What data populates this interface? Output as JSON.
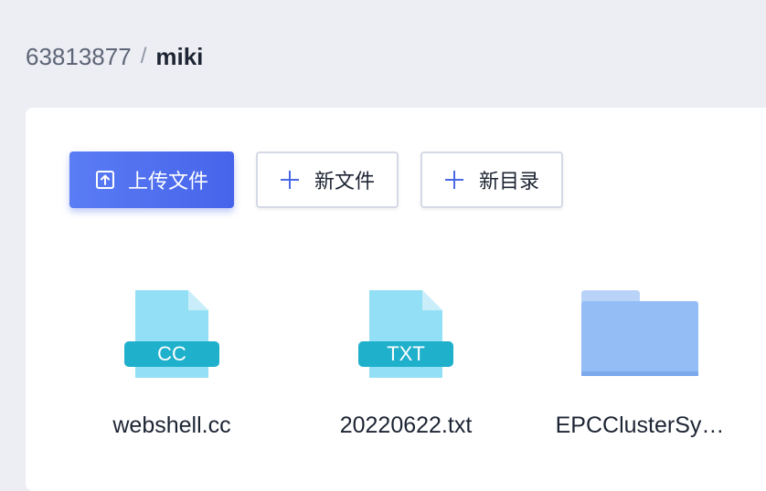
{
  "breadcrumb": {
    "parent": "63813877",
    "separator": "/",
    "current": "miki"
  },
  "toolbar": {
    "upload_label": "上传文件",
    "new_file_label": "新文件",
    "new_dir_label": "新目录"
  },
  "files": [
    {
      "name": "webshell.cc",
      "type": "file",
      "badge": "CC"
    },
    {
      "name": "20220622.txt",
      "type": "file",
      "badge": "TXT"
    },
    {
      "name": "EPCClusterSy…",
      "type": "folder"
    }
  ],
  "colors": {
    "primary": "#4f6ef0",
    "file_icon_body": "#93dff5",
    "file_icon_badge": "#1fb0cc",
    "folder": "#93bdf4"
  }
}
